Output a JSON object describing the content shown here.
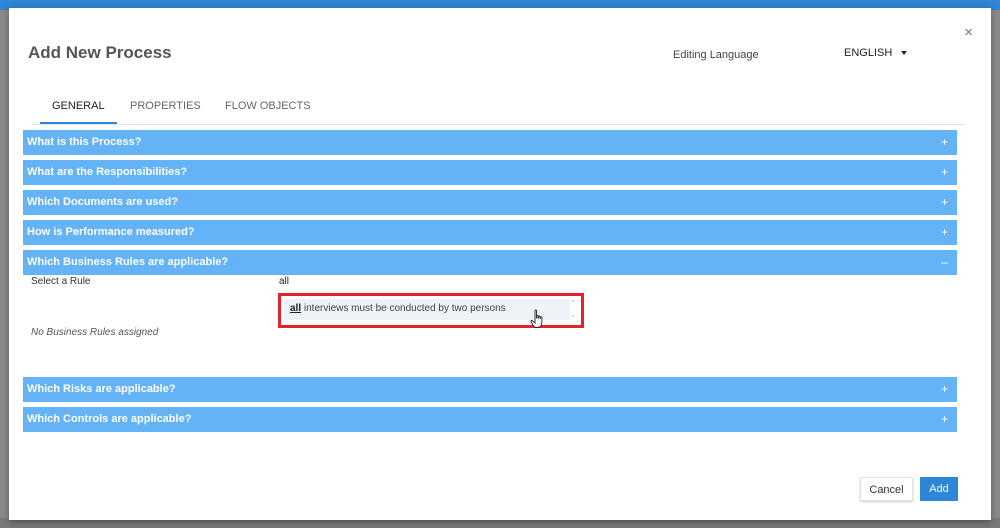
{
  "dialog": {
    "title": "Add New Process",
    "close_icon": "×",
    "editing_language_label": "Editing Language",
    "language_value": "ENGLISH"
  },
  "tabs": [
    {
      "label": "GENERAL",
      "active": true
    },
    {
      "label": "PROPERTIES",
      "active": false
    },
    {
      "label": "FLOW OBJECTS",
      "active": false
    }
  ],
  "sections": [
    {
      "label": "What is this Process?",
      "icon": "+"
    },
    {
      "label": "What are the Responsibilities?",
      "icon": "+"
    },
    {
      "label": "Which Documents are used?",
      "icon": "+"
    },
    {
      "label": "How is Performance measured?",
      "icon": "+"
    },
    {
      "label": "Which Business Rules are applicable?",
      "icon": "–"
    },
    {
      "label": "Which Risks are applicable?",
      "icon": "+"
    },
    {
      "label": "Which Controls are applicable?",
      "icon": "+"
    }
  ],
  "business_rules": {
    "select_label": "Select a Rule",
    "input_value": "all",
    "suggestion_match": "all",
    "suggestion_rest": " interviews must be conducted by two persons",
    "empty_text": "No Business Rules assigned"
  },
  "footer": {
    "cancel_label": "Cancel",
    "add_label": "Add"
  },
  "colors": {
    "accent": "#2f86d6",
    "section_bar": "#64b3f6",
    "highlight_border": "#e3222c"
  },
  "icons": [
    "close-icon",
    "chevron-down-icon",
    "expand-icon",
    "collapse-icon",
    "scroll-up-icon",
    "scroll-down-icon",
    "hand-pointer-icon"
  ]
}
